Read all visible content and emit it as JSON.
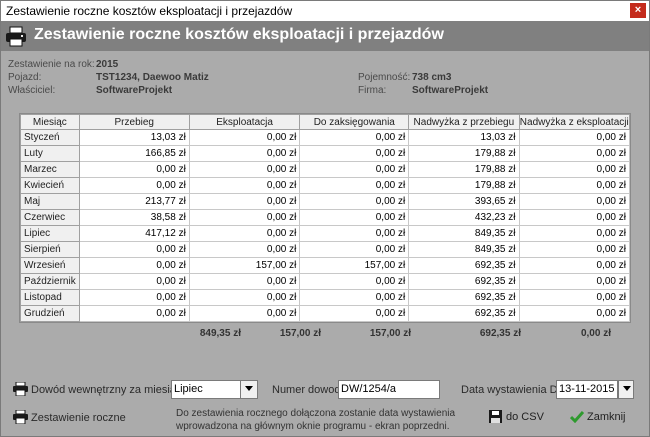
{
  "window": {
    "title": "Zestawienie roczne kosztów eksploatacji i przejazdów",
    "close": "×"
  },
  "header": {
    "title": "Zestawienie roczne kosztów eksploatacji i przejazdów"
  },
  "info": {
    "year_label": "Zestawienie na rok:",
    "year": "2015",
    "vehicle_label": "Pojazd:",
    "vehicle": "TST1234, Daewoo Matiz",
    "owner_label": "Właściciel:",
    "owner": "SoftwareProjekt",
    "capacity_label": "Pojemność:",
    "capacity": "738 cm3",
    "company_label": "Firma:",
    "company": "SoftwareProjekt"
  },
  "table": {
    "headers": [
      "Miesiąc",
      "Przebieg",
      "Eksploatacja",
      "Do zaksięgowania",
      "Nadwyżka z przebiegu",
      "Nadwyżka z eksploatacji"
    ],
    "rows": [
      [
        "Styczeń",
        "13,03 zł",
        "0,00 zł",
        "0,00 zł",
        "13,03 zł",
        "0,00 zł"
      ],
      [
        "Luty",
        "166,85 zł",
        "0,00 zł",
        "0,00 zł",
        "179,88 zł",
        "0,00 zł"
      ],
      [
        "Marzec",
        "0,00 zł",
        "0,00 zł",
        "0,00 zł",
        "179,88 zł",
        "0,00 zł"
      ],
      [
        "Kwiecień",
        "0,00 zł",
        "0,00 zł",
        "0,00 zł",
        "179,88 zł",
        "0,00 zł"
      ],
      [
        "Maj",
        "213,77 zł",
        "0,00 zł",
        "0,00 zł",
        "393,65 zł",
        "0,00 zł"
      ],
      [
        "Czerwiec",
        "38,58 zł",
        "0,00 zł",
        "0,00 zł",
        "432,23 zł",
        "0,00 zł"
      ],
      [
        "Lipiec",
        "417,12 zł",
        "0,00 zł",
        "0,00 zł",
        "849,35 zł",
        "0,00 zł"
      ],
      [
        "Sierpień",
        "0,00 zł",
        "0,00 zł",
        "0,00 zł",
        "849,35 zł",
        "0,00 zł"
      ],
      [
        "Wrzesień",
        "0,00 zł",
        "157,00 zł",
        "157,00 zł",
        "692,35 zł",
        "0,00 zł"
      ],
      [
        "Październik",
        "0,00 zł",
        "0,00 zł",
        "0,00 zł",
        "692,35 zł",
        "0,00 zł"
      ],
      [
        "Listopad",
        "0,00 zł",
        "0,00 zł",
        "0,00 zł",
        "692,35 zł",
        "0,00 zł"
      ],
      [
        "Grudzień",
        "0,00 zł",
        "0,00 zł",
        "0,00 zł",
        "692,35 zł",
        "0,00 zł"
      ]
    ],
    "totals": [
      "849,35 zł",
      "157,00 zł",
      "157,00 zł",
      "692,35 zł",
      "0,00 zł"
    ]
  },
  "bottom": {
    "internal_proof_label": "Dowód wewnętrzny za miesiąc:",
    "month_selected": "Lipiec",
    "proof_number_label": "Numer dowodu:",
    "proof_number": "DW/1254/a",
    "date_label": "Data wystawienia DW:",
    "date": "13-11-2015",
    "annual_label": "Zestawienie roczne",
    "note": "Do zestawienia rocznego  dołączona zostanie data wystawienia wprowadzona na głównym oknie programu - ekran poprzedni.",
    "csv_label": "do CSV",
    "close_label": "Zamknij"
  },
  "icons": {
    "printer": "printer-icon",
    "save": "floppy-disk-icon",
    "check": "checkmark-icon"
  }
}
